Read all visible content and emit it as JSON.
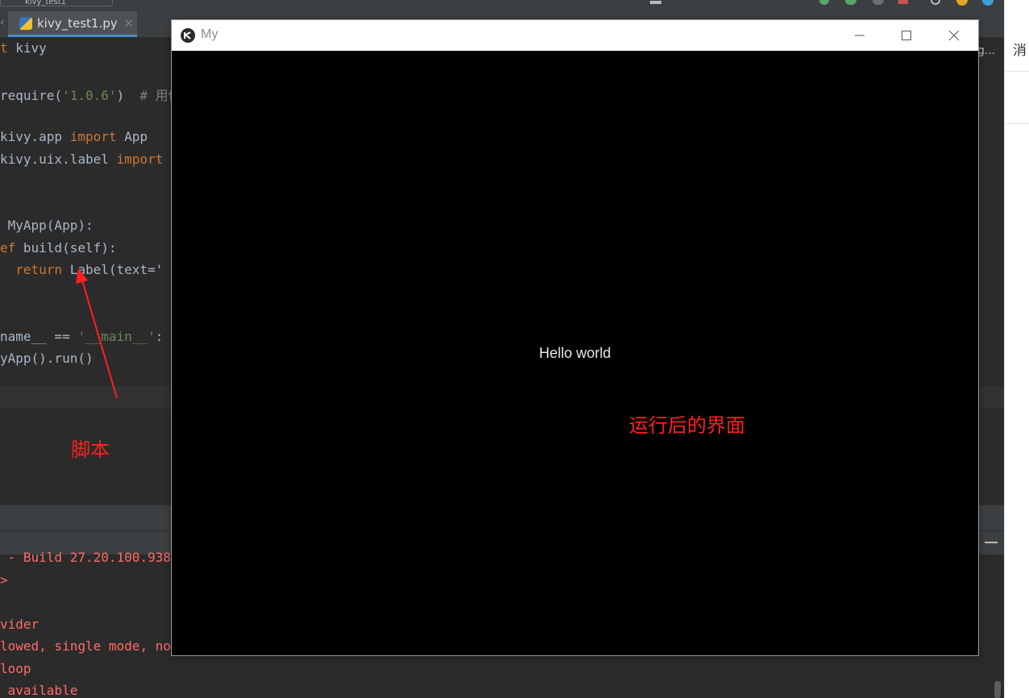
{
  "ide": {
    "tab": {
      "filename": "kivy_test1.py",
      "close": "×"
    },
    "run_config": "kivy_test1",
    "ellipsis": "g...",
    "right_strip_text": "消"
  },
  "code": {
    "lines": [
      {
        "parts": [
          {
            "t": "kw",
            "v": "t "
          },
          {
            "t": "plain",
            "v": "kivy"
          }
        ]
      },
      {
        "parts": []
      },
      {
        "parts": [
          {
            "t": "plain",
            "v": "require("
          },
          {
            "t": "str",
            "v": "'1.0.6'"
          },
          {
            "t": "plain",
            "v": ")  "
          },
          {
            "t": "cmt",
            "v": "# 用你"
          }
        ]
      },
      {
        "parts": []
      },
      {
        "parts": [
          {
            "t": "plain",
            "v": "kivy.app "
          },
          {
            "t": "kw",
            "v": "import"
          },
          {
            "t": "plain",
            "v": " App"
          }
        ]
      },
      {
        "parts": [
          {
            "t": "plain",
            "v": "kivy.uix.label "
          },
          {
            "t": "kw",
            "v": "import"
          }
        ]
      },
      {
        "parts": []
      },
      {
        "parts": []
      },
      {
        "parts": [
          {
            "t": "plain",
            "v": " MyApp(App):"
          }
        ]
      },
      {
        "parts": [
          {
            "t": "kw",
            "v": "ef"
          },
          {
            "t": "plain",
            "v": " build(self):"
          }
        ]
      },
      {
        "parts": [
          {
            "t": "plain",
            "v": "  "
          },
          {
            "t": "kw",
            "v": "return"
          },
          {
            "t": "plain",
            "v": " Label(text='"
          }
        ]
      },
      {
        "parts": []
      },
      {
        "parts": []
      },
      {
        "parts": [
          {
            "t": "plain",
            "v": "name__ == "
          },
          {
            "t": "str",
            "v": "'__main__'"
          },
          {
            "t": "plain",
            "v": ":"
          }
        ]
      },
      {
        "parts": [
          {
            "t": "plain",
            "v": "yApp().run()"
          }
        ]
      }
    ]
  },
  "console": {
    "lines": [
      " - Build 27.20.100.938",
      ">",
      "",
      "vider",
      "lowed, single mode, no",
      "loop",
      " available"
    ]
  },
  "annotations": {
    "script_label": "脚本",
    "ui_label": "运行后的界面"
  },
  "kivy_window": {
    "title": "My",
    "label_text": "Hello world"
  }
}
